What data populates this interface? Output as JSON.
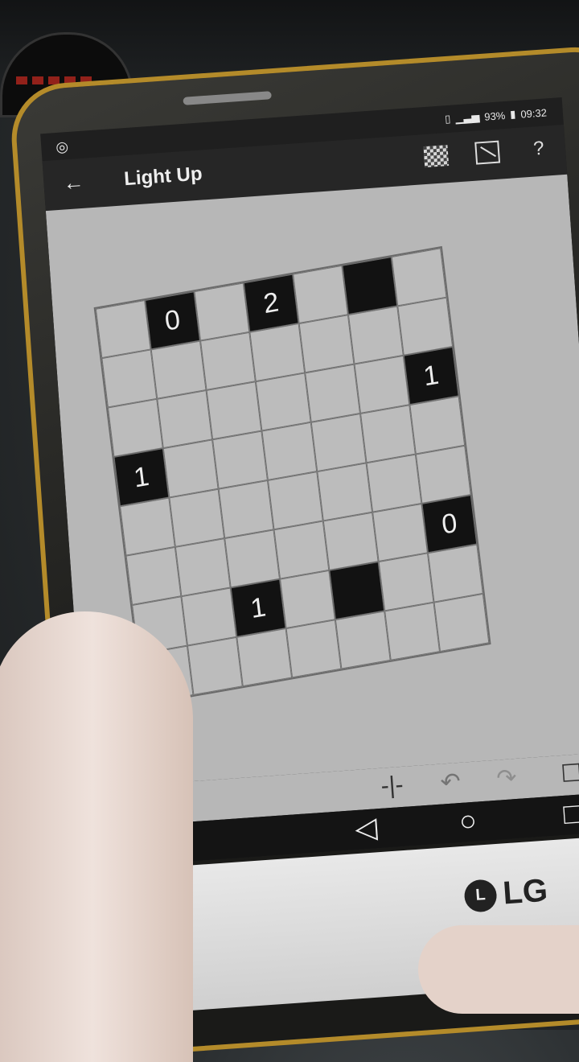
{
  "status": {
    "left_icon": "whatsapp-icon",
    "battery": "93%",
    "time": "09:32"
  },
  "appbar": {
    "back_icon": "back-arrow-icon",
    "title": "Light Up",
    "help_label": "?"
  },
  "board": {
    "columns": 7,
    "rows": 8,
    "cells": [
      [
        "",
        "0",
        "",
        "2",
        "",
        "#",
        ""
      ],
      [
        "",
        "",
        "",
        "",
        "",
        "",
        ""
      ],
      [
        "",
        "",
        "",
        "",
        "",
        "",
        "1"
      ],
      [
        "1",
        "",
        "",
        "",
        "",
        "",
        ""
      ],
      [
        "",
        "",
        "",
        "",
        "",
        "",
        ""
      ],
      [
        "",
        "",
        "",
        "",
        "",
        "",
        "0"
      ],
      [
        "",
        "",
        "1",
        "",
        "#",
        "",
        ""
      ],
      [
        "",
        "",
        "",
        "",
        "",
        "",
        ""
      ]
    ]
  },
  "controls": {
    "tool_icon": "marker-toggle-icon",
    "undo_icon": "undo-icon",
    "redo_icon": "redo-icon"
  },
  "navbar": {
    "back_icon": "nav-back-icon",
    "home_icon": "nav-home-icon",
    "recents_icon": "nav-recents-icon"
  },
  "device": {
    "brand": "LG"
  }
}
